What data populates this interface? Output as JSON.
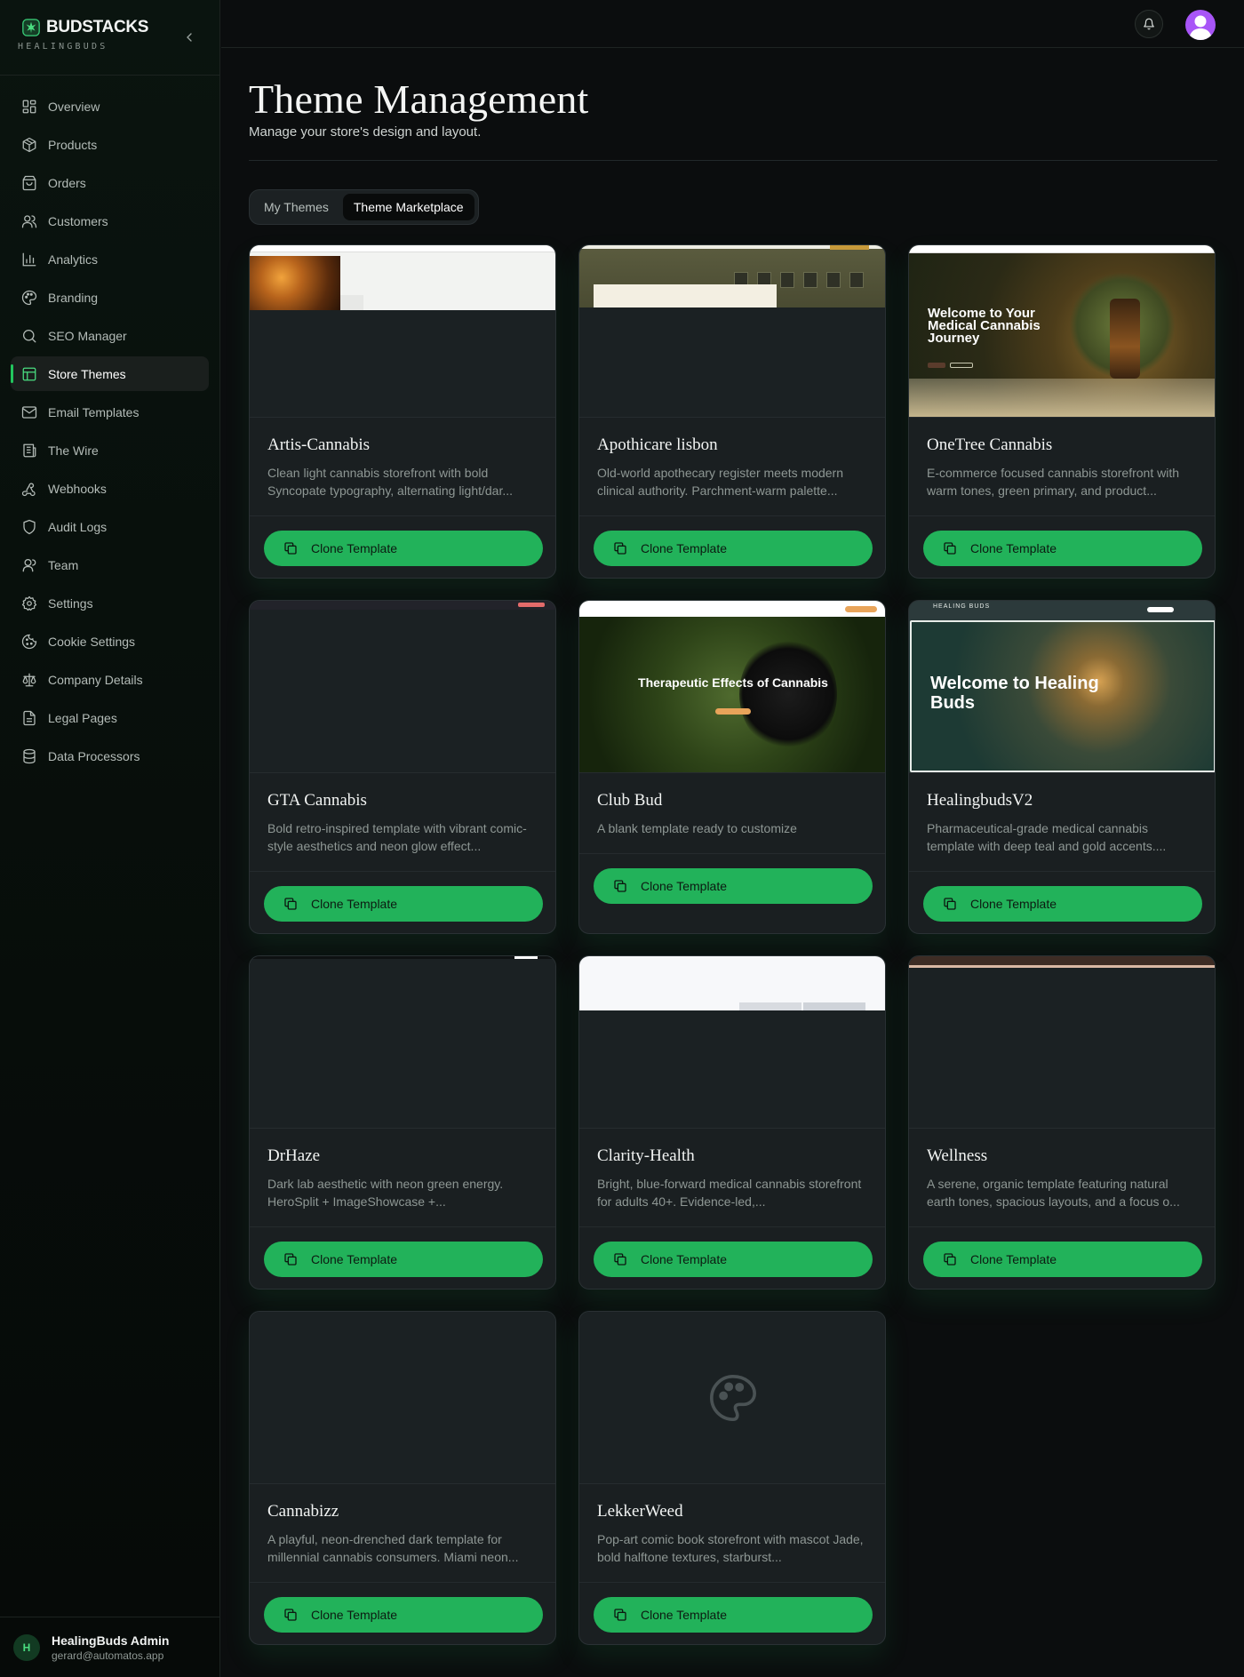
{
  "brand": {
    "name": "BUDSTACKS",
    "subtitle": "HEALINGBUDS"
  },
  "nav": [
    {
      "label": "Overview",
      "icon": "grid-icon"
    },
    {
      "label": "Products",
      "icon": "box-icon"
    },
    {
      "label": "Orders",
      "icon": "bag-icon"
    },
    {
      "label": "Customers",
      "icon": "users-icon"
    },
    {
      "label": "Analytics",
      "icon": "bar-chart-icon"
    },
    {
      "label": "Branding",
      "icon": "palette-icon"
    },
    {
      "label": "SEO Manager",
      "icon": "search-icon"
    },
    {
      "label": "Store Themes",
      "icon": "layout-icon",
      "active": true
    },
    {
      "label": "Email Templates",
      "icon": "mail-icon"
    },
    {
      "label": "The Wire",
      "icon": "newspaper-icon"
    },
    {
      "label": "Webhooks",
      "icon": "webhook-icon"
    },
    {
      "label": "Audit Logs",
      "icon": "shield-icon"
    },
    {
      "label": "Team",
      "icon": "user-icon"
    },
    {
      "label": "Settings",
      "icon": "gear-icon"
    },
    {
      "label": "Cookie Settings",
      "icon": "cookie-icon"
    },
    {
      "label": "Company Details",
      "icon": "scale-icon"
    },
    {
      "label": "Legal Pages",
      "icon": "file-icon"
    },
    {
      "label": "Data Processors",
      "icon": "database-icon"
    }
  ],
  "user": {
    "initial": "H",
    "name": "HealingBuds Admin",
    "email": "gerard@automatos.app"
  },
  "page": {
    "title": "Theme Management",
    "subtitle": "Manage your store's design and layout."
  },
  "tabs": [
    {
      "label": "My Themes"
    },
    {
      "label": "Theme Marketplace",
      "active": true
    }
  ],
  "clone_label": "Clone Template",
  "templates": [
    {
      "name": "Artis-Cannabis",
      "desc": "Clean light cannabis storefront with bold Syncopate typography, alternating light/dar..."
    },
    {
      "name": "Apothicare lisbon",
      "desc": "Old-world apothecary register meets modern clinical authority. Parchment-warm palette..."
    },
    {
      "name": "OneTree Cannabis",
      "desc": "E-commerce focused cannabis storefront with warm tones, green primary, and product..."
    },
    {
      "name": "GTA Cannabis",
      "desc": "Bold retro-inspired template with vibrant comic-style aesthetics and neon glow effect..."
    },
    {
      "name": "Club Bud",
      "desc": "A blank template ready to customize"
    },
    {
      "name": "HealingbudsV2",
      "desc": "Pharmaceutical-grade medical cannabis template with deep teal and gold accents...."
    },
    {
      "name": "DrHaze",
      "desc": "Dark lab aesthetic with neon green energy. HeroSplit + ImageShowcase +..."
    },
    {
      "name": "Clarity-Health",
      "desc": "Bright, blue-forward medical cannabis storefront for adults 40+. Evidence-led,..."
    },
    {
      "name": "Wellness",
      "desc": "A serene, organic template featuring natural earth tones, spacious layouts, and a focus o..."
    },
    {
      "name": "Cannabizz",
      "desc": "A playful, neon-drenched dark template for millennial cannabis consumers. Miami neon..."
    },
    {
      "name": "LekkerWeed",
      "desc": "Pop-art comic book storefront with mascot Jade, bold halftone textures, starburst..."
    }
  ],
  "thumbs": {
    "onetree_hero": "Welcome to Your Medical Cannabis Journey",
    "clubbud_hero": "Therapeutic Effects of Cannabis",
    "healing_hero": "Welcome to Healing Buds",
    "healing_logo": "HEALING BUDS"
  },
  "colors": {
    "accent": "#22b25a",
    "active_indicator": "#22c55e",
    "avatar": "#a855f7"
  }
}
